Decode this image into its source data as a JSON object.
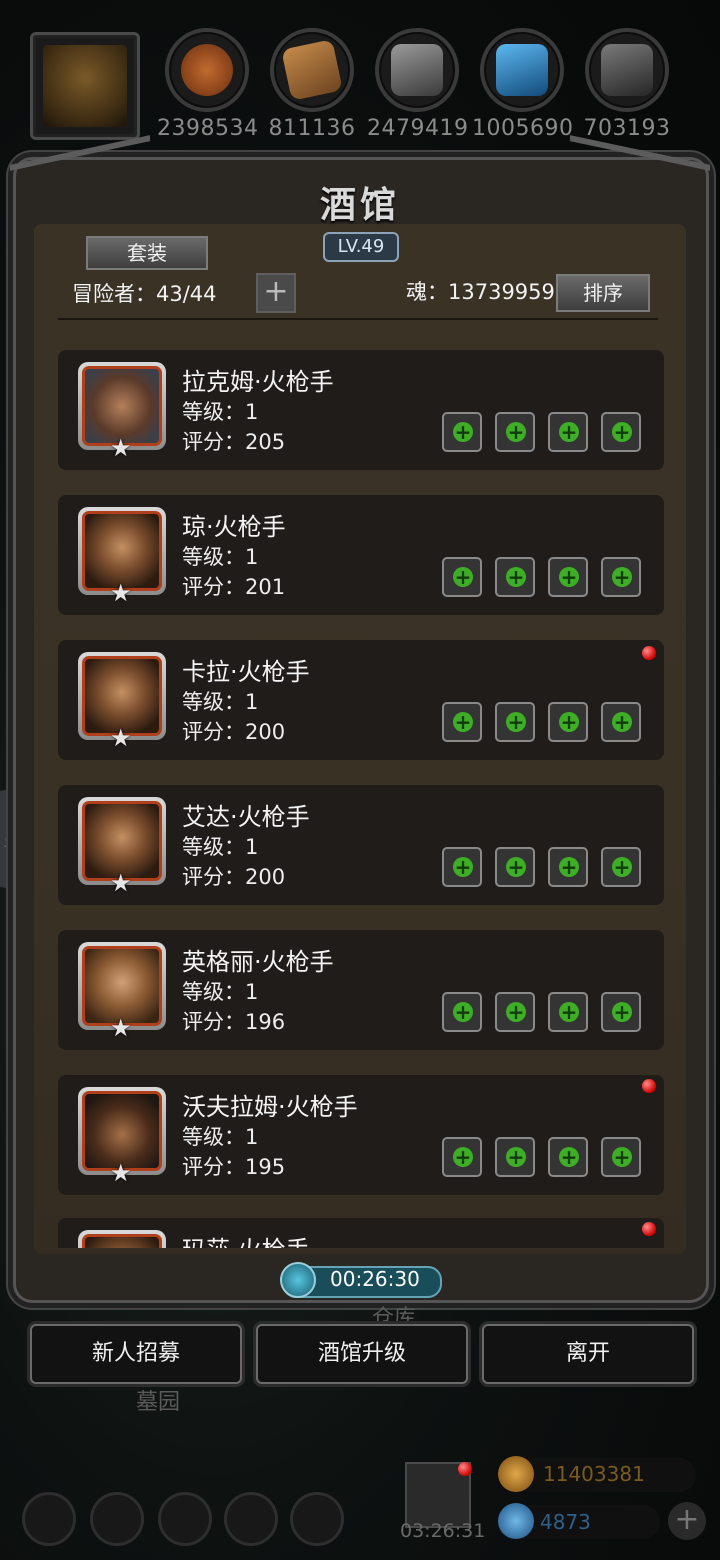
{
  "resources": [
    {
      "icon": "meat-icon",
      "value": "2398534",
      "color": "#b5541f"
    },
    {
      "icon": "wood-icon",
      "value": "811136",
      "color": "#a8733a"
    },
    {
      "icon": "iron-icon",
      "value": "2479419",
      "color": "#6f6f6f"
    },
    {
      "icon": "crystal-icon",
      "value": "1005690",
      "color": "#2c86c9"
    },
    {
      "icon": "ore-icon",
      "value": "703193",
      "color": "#555555"
    }
  ],
  "tavern": {
    "title": "酒馆",
    "level": "LV.49",
    "outfit_label": "套装",
    "adventurers": "冒险者：43/44",
    "soul": "魂：13739959",
    "sort_label": "排序"
  },
  "heroes": [
    {
      "name": "拉克姆·火枪手",
      "level": "等级：1",
      "score": "评分：205",
      "alert": false
    },
    {
      "name": "琼·火枪手",
      "level": "等级：1",
      "score": "评分：201",
      "alert": false
    },
    {
      "name": "卡拉·火枪手",
      "level": "等级：1",
      "score": "评分：200",
      "alert": true
    },
    {
      "name": "艾达·火枪手",
      "level": "等级：1",
      "score": "评分：200",
      "alert": false
    },
    {
      "name": "英格丽·火枪手",
      "level": "等级：1",
      "score": "评分：196",
      "alert": false
    },
    {
      "name": "沃夫拉姆·火枪手",
      "level": "等级：1",
      "score": "评分：195",
      "alert": true
    },
    {
      "name": "玛莎·火枪手",
      "level": "",
      "score": "",
      "alert": true
    }
  ],
  "timer": "00:26:30",
  "buttons": {
    "recruit": "新人招募",
    "upgrade": "酒馆升级",
    "leave": "离开"
  },
  "background_labels": {
    "warehouse": "仓库",
    "cemetery": "墓园"
  },
  "bottom_bar": {
    "gift_timer": "03:26:31",
    "gold": "11403381",
    "gems": "4873"
  }
}
